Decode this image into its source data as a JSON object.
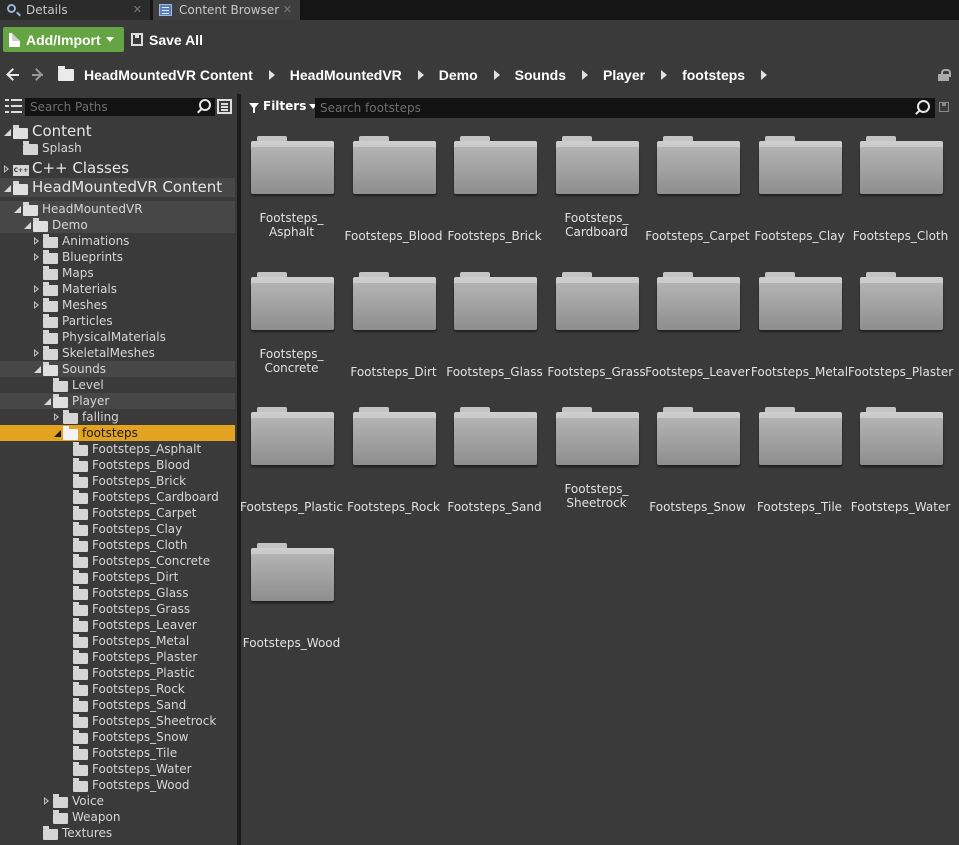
{
  "tabs": [
    {
      "label": "Details",
      "icon": "magnifier-icon"
    },
    {
      "label": "Content Browser",
      "icon": "content-browser-icon"
    }
  ],
  "toolbar": {
    "add_import": "Add/Import",
    "save_all": "Save All"
  },
  "breadcrumb": [
    "HeadMountedVR Content",
    "HeadMountedVR",
    "Demo",
    "Sounds",
    "Player",
    "footsteps"
  ],
  "sidebar": {
    "search_placeholder": "Search Paths",
    "tree": [
      {
        "label": "Content"
      },
      {
        "label": "Splash"
      },
      {
        "label": "C++ Classes"
      },
      {
        "label": "HeadMountedVR Content"
      },
      {
        "label": "HeadMountedVR"
      },
      {
        "label": "Demo"
      },
      {
        "label": "Animations"
      },
      {
        "label": "Blueprints"
      },
      {
        "label": "Maps"
      },
      {
        "label": "Materials"
      },
      {
        "label": "Meshes"
      },
      {
        "label": "Particles"
      },
      {
        "label": "PhysicalMaterials"
      },
      {
        "label": "SkeletalMeshes"
      },
      {
        "label": "Sounds"
      },
      {
        "label": "Level"
      },
      {
        "label": "Player"
      },
      {
        "label": "falling"
      },
      {
        "label": "footsteps"
      },
      {
        "label": "Footsteps_Asphalt"
      },
      {
        "label": "Footsteps_Blood"
      },
      {
        "label": "Footsteps_Brick"
      },
      {
        "label": "Footsteps_Cardboard"
      },
      {
        "label": "Footsteps_Carpet"
      },
      {
        "label": "Footsteps_Clay"
      },
      {
        "label": "Footsteps_Cloth"
      },
      {
        "label": "Footsteps_Concrete"
      },
      {
        "label": "Footsteps_Dirt"
      },
      {
        "label": "Footsteps_Glass"
      },
      {
        "label": "Footsteps_Grass"
      },
      {
        "label": "Footsteps_Leaver"
      },
      {
        "label": "Footsteps_Metal"
      },
      {
        "label": "Footsteps_Plaster"
      },
      {
        "label": "Footsteps_Plastic"
      },
      {
        "label": "Footsteps_Rock"
      },
      {
        "label": "Footsteps_Sand"
      },
      {
        "label": "Footsteps_Sheetrock"
      },
      {
        "label": "Footsteps_Snow"
      },
      {
        "label": "Footsteps_Tile"
      },
      {
        "label": "Footsteps_Water"
      },
      {
        "label": "Footsteps_Wood"
      },
      {
        "label": "Voice"
      },
      {
        "label": "Weapon"
      },
      {
        "label": "Textures"
      }
    ]
  },
  "content": {
    "filters_label": "Filters",
    "search_placeholder": "Search footsteps",
    "folders": [
      {
        "line1": "Footsteps_",
        "line2": "Asphalt"
      },
      {
        "line1": "Footsteps_Blood",
        "line2": ""
      },
      {
        "line1": "Footsteps_Brick",
        "line2": ""
      },
      {
        "line1": "Footsteps_",
        "line2": "Cardboard"
      },
      {
        "line1": "Footsteps_Carpet",
        "line2": ""
      },
      {
        "line1": "Footsteps_Clay",
        "line2": ""
      },
      {
        "line1": "Footsteps_Cloth",
        "line2": ""
      },
      {
        "line1": "Footsteps_",
        "line2": "Concrete"
      },
      {
        "line1": "Footsteps_Dirt",
        "line2": ""
      },
      {
        "line1": "Footsteps_Glass",
        "line2": ""
      },
      {
        "line1": "Footsteps_Grass",
        "line2": ""
      },
      {
        "line1": "Footsteps_Leaver",
        "line2": ""
      },
      {
        "line1": "Footsteps_Metal",
        "line2": ""
      },
      {
        "line1": "Footsteps_Plaster",
        "line2": ""
      },
      {
        "line1": "Footsteps_Plastic",
        "line2": ""
      },
      {
        "line1": "Footsteps_Rock",
        "line2": ""
      },
      {
        "line1": "Footsteps_Sand",
        "line2": ""
      },
      {
        "line1": "Footsteps_",
        "line2": "Sheetrock"
      },
      {
        "line1": "Footsteps_Snow",
        "line2": ""
      },
      {
        "line1": "Footsteps_Tile",
        "line2": ""
      },
      {
        "line1": "Footsteps_Water",
        "line2": ""
      },
      {
        "line1": "Footsteps_Wood",
        "line2": ""
      }
    ]
  },
  "colors": {
    "accent_selected": "#e2a320",
    "add_button": "#64a443"
  }
}
